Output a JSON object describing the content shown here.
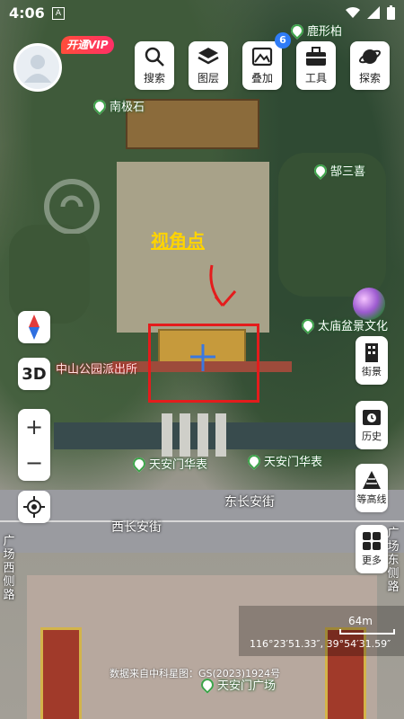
{
  "status_bar": {
    "time": "4:06",
    "a_icon": "A"
  },
  "account": {
    "vip_label": "开通VIP"
  },
  "toolbar": {
    "search": "搜索",
    "layers": "图层",
    "overlay": "叠加",
    "overlay_badge": "6",
    "tools": "工具",
    "explore": "探索"
  },
  "map": {
    "view_point_label": "视角点",
    "pois": [
      {
        "name": "鹿形柏"
      },
      {
        "name": "南极石"
      },
      {
        "name": "郜三喜"
      },
      {
        "name": "太庙盆景文化"
      },
      {
        "name": "中山公园派出所"
      },
      {
        "name": "天安门华表"
      },
      {
        "name": "天安门华表"
      },
      {
        "name": "天安门广场"
      }
    ],
    "streets": {
      "east": "东长安街",
      "west": "西长安街",
      "left_vertical": "广场西侧路",
      "right_vertical": "广场东侧路"
    }
  },
  "left_controls": {
    "mode_3d": "3D",
    "zoom_in": "+",
    "zoom_out": "−"
  },
  "right_controls": {
    "street_view": "街景",
    "history": "历史",
    "contour": "等高线",
    "more": "更多"
  },
  "scale": {
    "label": "64m",
    "coords": "116°23′51.33″, 39°54′31.59″"
  },
  "credit": "数据来自中科星图：GS(2023)1924号",
  "colors": {
    "accent": "#2f7cf6",
    "poi_green": "#3da34a",
    "highlight_red": "#e41c1c",
    "label_yellow": "#ffd400"
  }
}
